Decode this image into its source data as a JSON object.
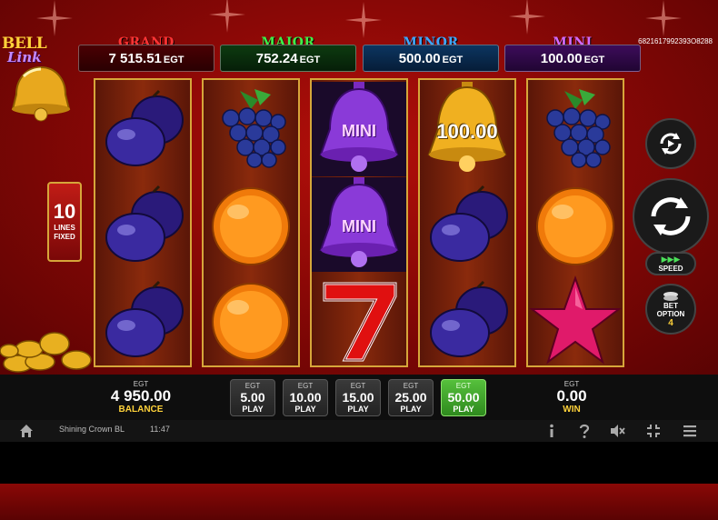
{
  "app": {
    "logo_top": "BELL",
    "logo_bottom": "Link",
    "game_id": "6821617992393O8288"
  },
  "jackpots": [
    {
      "label": "GRAND",
      "value": "7 515.51",
      "currency": "EGT"
    },
    {
      "label": "MAJOR",
      "value": "752.24",
      "currency": "EGT"
    },
    {
      "label": "MINOR",
      "value": "500.00",
      "currency": "EGT"
    },
    {
      "label": "MINI",
      "value": "100.00",
      "currency": "EGT"
    }
  ],
  "reels": [
    [
      "plum",
      "plum",
      "plum"
    ],
    [
      "grapes",
      "orange",
      "orange"
    ],
    [
      "bell-purple",
      "bell-purple",
      "seven"
    ],
    [
      "bell-gold",
      "plum",
      "plum"
    ],
    [
      "grapes",
      "orange",
      "star"
    ]
  ],
  "reel_labels": {
    "mini_1": "MINI",
    "mini_2": "MINI",
    "gold_value": "100.00"
  },
  "lines": {
    "count": "10",
    "label_1": "LINES",
    "label_2": "FIXED"
  },
  "controls": {
    "speed_label": "SPEED",
    "bet_option_label_1": "BET",
    "bet_option_label_2": "OPTION",
    "bet_option_value": "4"
  },
  "balance": {
    "currency": "EGT",
    "value": "4 950.00",
    "label": "BALANCE"
  },
  "win": {
    "currency": "EGT",
    "value": "0.00",
    "label": "WIN"
  },
  "bets": [
    {
      "currency": "EGT",
      "value": "5.00",
      "label": "PLAY",
      "active": false
    },
    {
      "currency": "EGT",
      "value": "10.00",
      "label": "PLAY",
      "active": false
    },
    {
      "currency": "EGT",
      "value": "15.00",
      "label": "PLAY",
      "active": false
    },
    {
      "currency": "EGT",
      "value": "25.00",
      "label": "PLAY",
      "active": false
    },
    {
      "currency": "EGT",
      "value": "50.00",
      "label": "PLAY",
      "active": true
    }
  ],
  "status_bar": {
    "game_name": "Shining Crown BL",
    "time": "11:47"
  },
  "colors": {
    "grand": "#ff3434",
    "major": "#3ef04a",
    "minor": "#3ea8ff",
    "mini": "#d46bff",
    "active_bet": "#56c03c",
    "gold": "#ffd23a"
  }
}
